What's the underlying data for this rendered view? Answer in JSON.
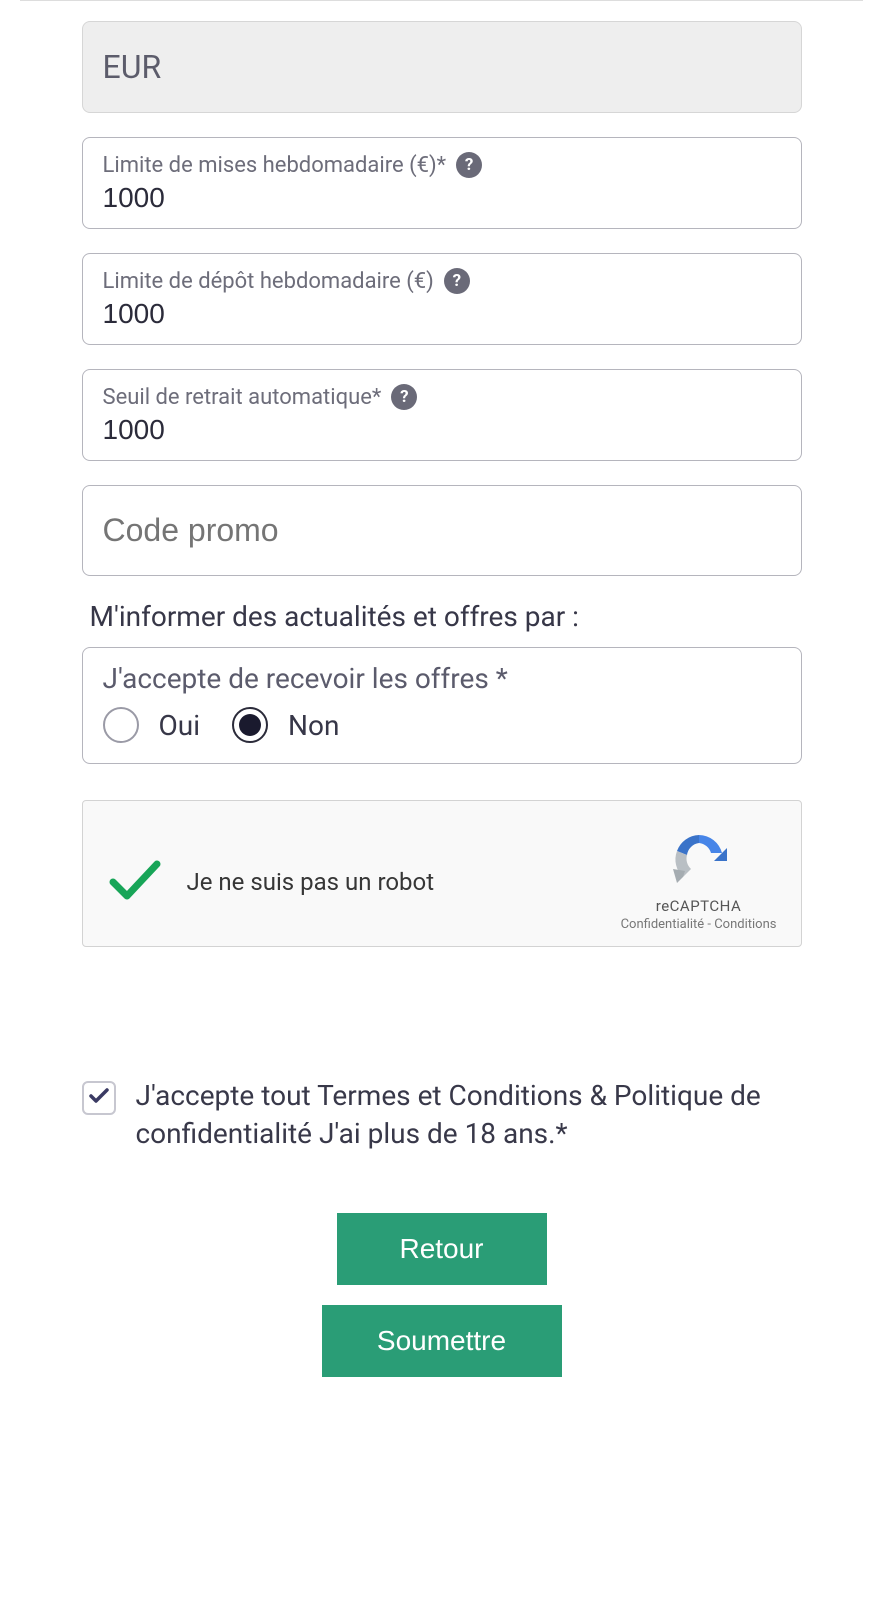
{
  "currency": {
    "value": "EUR"
  },
  "fields": {
    "bet_limit": {
      "label": "Limite de mises hebdomadaire (€)*",
      "value": "1000"
    },
    "deposit_limit": {
      "label": "Limite de dépôt hebdomadaire (€)",
      "value": "1000"
    },
    "withdrawal_threshold": {
      "label": "Seuil de retrait automatique*",
      "value": "1000"
    },
    "promo": {
      "placeholder": "Code promo",
      "value": ""
    }
  },
  "newsletter": {
    "section_label": "M'informer des actualités et offres par :",
    "question": "J'accepte de recevoir les offres *",
    "options": {
      "yes": "Oui",
      "no": "Non"
    },
    "selected": "no"
  },
  "captcha": {
    "text": "Je ne suis pas un robot",
    "brand": "reCAPTCHA",
    "links": "Confidentialité - Conditions",
    "checked": true
  },
  "terms": {
    "checked": true,
    "text": "J'accepte tout Termes et Conditions    & Politique de confidentialité    J'ai plus de 18 ans.*"
  },
  "buttons": {
    "back": "Retour",
    "submit": "Soumettre"
  },
  "help_glyph": "?"
}
